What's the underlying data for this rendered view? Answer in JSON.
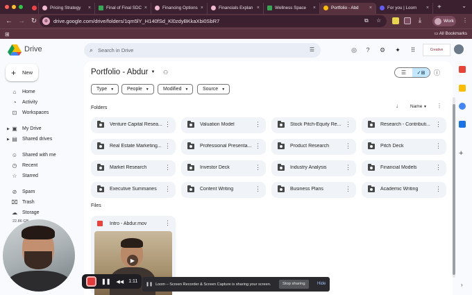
{
  "browser": {
    "tabs": [
      {
        "label": "Pricing Strategy",
        "color": "#f2b8d0",
        "active": false
      },
      {
        "label": "Final of Final SDC",
        "color": "#34a853",
        "active": false
      },
      {
        "label": "Financing Options",
        "color": "#f2b8d0",
        "active": false
      },
      {
        "label": "Financials Explan",
        "color": "#f2b8d0",
        "active": false
      },
      {
        "label": "Wellness Space",
        "color": "#34a853",
        "active": false
      },
      {
        "label": "Portfolio - Abd",
        "color": "#fbbc04",
        "active": true
      },
      {
        "label": "For you | Loom",
        "color": "#625df5",
        "active": false
      }
    ],
    "url": "drive.google.com/drive/folders/1qm5lY_H140fSd_Kl0zdyBKkaXbi0SbR7",
    "profile_label": "Work",
    "all_bookmarks_label": "All Bookmarks"
  },
  "header": {
    "app_name": "Drive",
    "search_placeholder": "Search in Drive"
  },
  "sidebar": {
    "new_label": "New",
    "items": [
      {
        "label": "Home",
        "icon": "home-icon",
        "glyph": "⌂"
      },
      {
        "label": "Activity",
        "icon": "activity-icon",
        "glyph": "◔"
      },
      {
        "label": "Workspaces",
        "icon": "workspaces-icon",
        "glyph": "⊡"
      },
      {
        "label": "My Drive",
        "icon": "my-drive-icon",
        "glyph": "▣"
      },
      {
        "label": "Shared drives",
        "icon": "shared-drives-icon",
        "glyph": "▤"
      },
      {
        "label": "Shared with me",
        "icon": "shared-with-me-icon",
        "glyph": "☺"
      },
      {
        "label": "Recent",
        "icon": "recent-icon",
        "glyph": "◷"
      },
      {
        "label": "Starred",
        "icon": "star-icon",
        "glyph": "☆"
      },
      {
        "label": "Spam",
        "icon": "spam-icon",
        "glyph": "⊘"
      },
      {
        "label": "Trash",
        "icon": "trash-icon",
        "glyph": "🗑"
      },
      {
        "label": "Storage",
        "icon": "cloud-icon",
        "glyph": "☁"
      }
    ],
    "storage_text": "22.86 GB"
  },
  "main": {
    "title": "Portfolio - Abdur",
    "filters": [
      "Type",
      "People",
      "Modified",
      "Source"
    ],
    "folders_label": "Folders",
    "files_label": "Files",
    "sort_label": "Name",
    "folders": [
      "Venture Capital Resea...",
      "Valuation Model",
      "Stock Pitch-Equity Re...",
      "Research - Contributi...",
      "Real Estate Marketing...",
      "Professional Presenta...",
      "Product Research",
      "Pitch Deck",
      "Market Research",
      "Investor Deck",
      "Industry Analysis",
      "Financial Models",
      "Executive Summaries",
      "Content Writing",
      "Business Plans",
      "Academic Writing"
    ],
    "files": [
      {
        "name": "Intro - Abdur.mov"
      }
    ]
  },
  "loom": {
    "timer": "1:11",
    "sharing_message": "Loom – Screen Recorder & Screen Capture is sharing your screen.",
    "stop_label": "Stop sharing",
    "hide_label": "Hide"
  },
  "brand_logo_text": "Creative"
}
